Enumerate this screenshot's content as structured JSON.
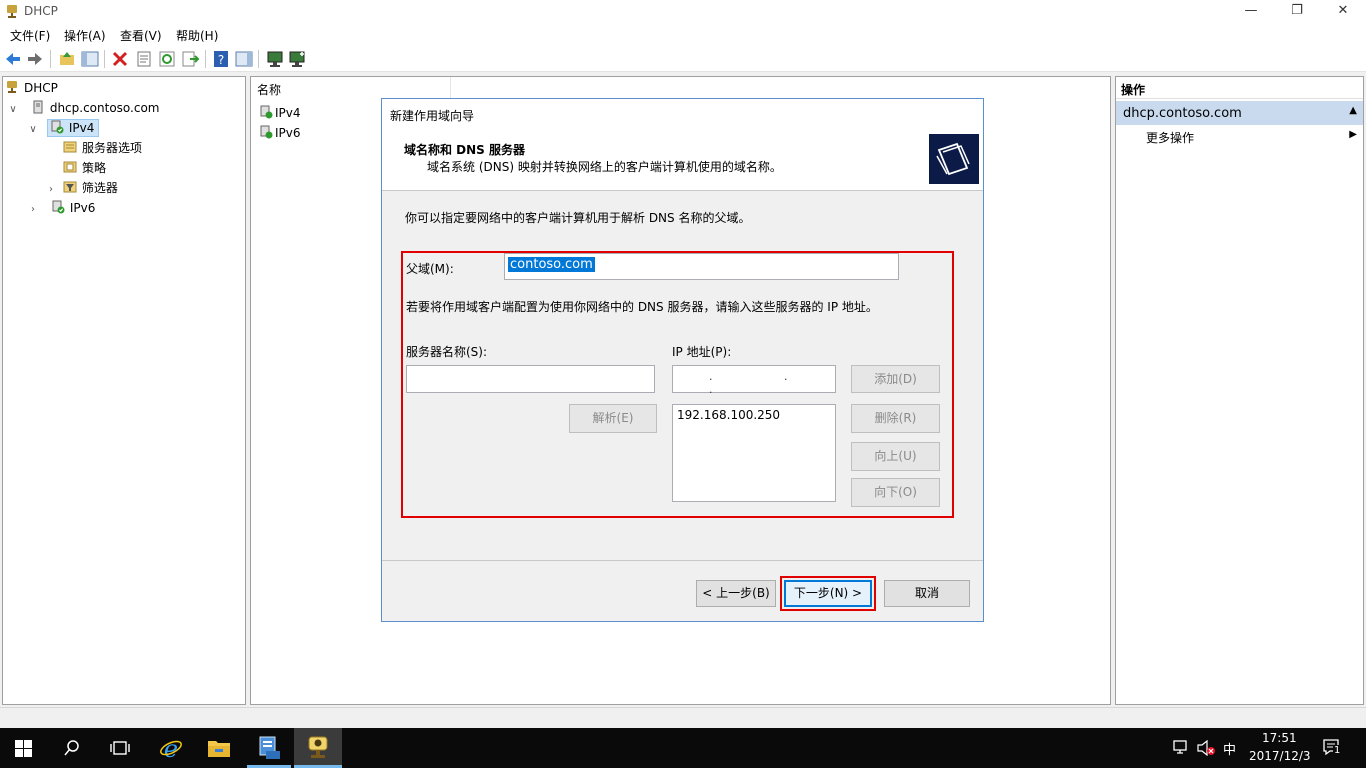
{
  "window": {
    "title": "DHCP"
  },
  "menu": {
    "file": "文件(F)",
    "action": "操作(A)",
    "view": "查看(V)",
    "help": "帮助(H)"
  },
  "toolbar_icons": [
    "back-arrow-icon",
    "forward-arrow-icon",
    "up-folder-icon",
    "show-hide-tree-icon",
    "delete-icon",
    "properties-icon",
    "refresh-icon",
    "export-icon",
    "help-icon",
    "show-action-pane-icon",
    "server-icon",
    "add-server-icon"
  ],
  "tree": {
    "root": "DHCP",
    "server": "dhcp.contoso.com",
    "ipv4": "IPv4",
    "server_options": "服务器选项",
    "policies": "策略",
    "filters": "筛选器",
    "ipv6": "IPv6"
  },
  "list": {
    "column_name": "名称",
    "items": [
      "IPv4",
      "IPv6"
    ]
  },
  "actions": {
    "header": "操作",
    "section": "dhcp.contoso.com",
    "more": "更多操作"
  },
  "wizard": {
    "title": "新建作用域向导",
    "heading": "域名称和 DNS 服务器",
    "subheading": "域名系统 (DNS) 映射并转换网络上的客户端计算机使用的域名称。",
    "intro": "你可以指定要网络中的客户端计算机用于解析 DNS 名称的父域。",
    "parent_domain_label": "父域(M):",
    "parent_domain_value": "contoso.com",
    "dns_hint": "若要将作用域客户端配置为使用你网络中的 DNS 服务器，请输入这些服务器的 IP 地址。",
    "server_name_label": "服务器名称(S):",
    "server_name_value": "",
    "ip_label": "IP 地址(P):",
    "ip_value": ". . .",
    "resolve_button": "解析(E)",
    "add_button": "添加(D)",
    "remove_button": "删除(R)",
    "up_button": "向上(U)",
    "down_button": "向下(O)",
    "ip_list": [
      "192.168.100.250"
    ],
    "back_button": "< 上一步(B)",
    "next_button": "下一步(N) >",
    "cancel_button": "取消"
  },
  "taskbar": {
    "time": "17:51",
    "date": "2017/12/3",
    "ime": "中",
    "notifications": "1"
  },
  "colors": {
    "highlight_red": "#e00000",
    "selection_blue": "#0078d7",
    "accent": "#1e6fc2"
  }
}
